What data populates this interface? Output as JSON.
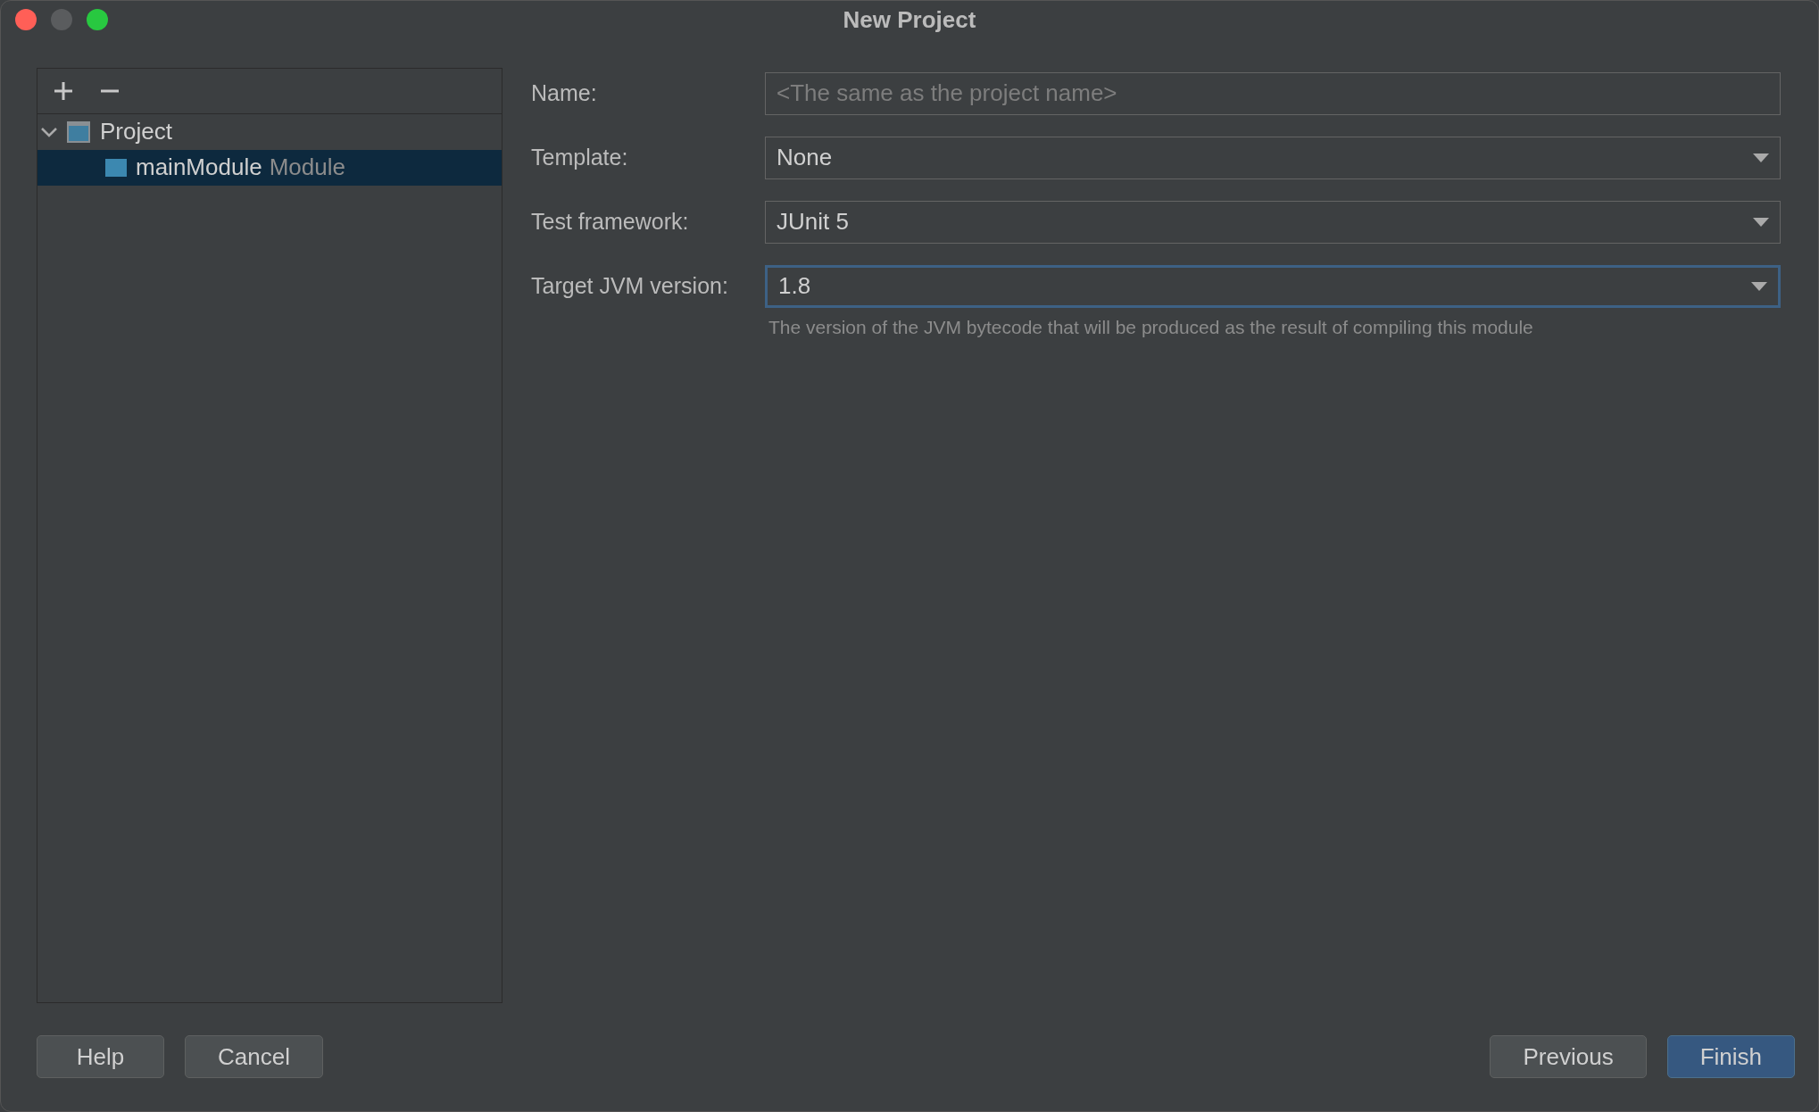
{
  "window": {
    "title": "New Project"
  },
  "toolbar": {
    "buttons": [
      {
        "kind": "add"
      },
      {
        "kind": "remove"
      }
    ]
  },
  "tree": [
    {
      "label": "Project",
      "kind": "project",
      "expanded": true,
      "selected": false,
      "children": [
        {
          "label": "mainModule",
          "suffix": "Module",
          "kind": "module",
          "selected": true
        }
      ]
    }
  ],
  "form": [
    {
      "label": "Name:",
      "kind": "text",
      "placeholder": "<The same as the project name>",
      "focused": false
    },
    {
      "label": "Template:",
      "kind": "dropdown",
      "value": "None",
      "focused": false
    },
    {
      "label": "Test framework:",
      "kind": "dropdown",
      "value": "JUnit 5",
      "focused": false
    },
    {
      "label": "Target JVM version:",
      "kind": "dropdown",
      "value": "1.8",
      "focused": true,
      "hint": "The version of the JVM bytecode that will be produced as the result of compiling this module"
    }
  ],
  "buttons_left": [
    {
      "label": "Help",
      "primary": false
    },
    {
      "label": "Cancel",
      "primary": false
    }
  ],
  "buttons_right": [
    {
      "label": "Previous",
      "primary": false
    },
    {
      "label": "Finish",
      "primary": true
    }
  ]
}
